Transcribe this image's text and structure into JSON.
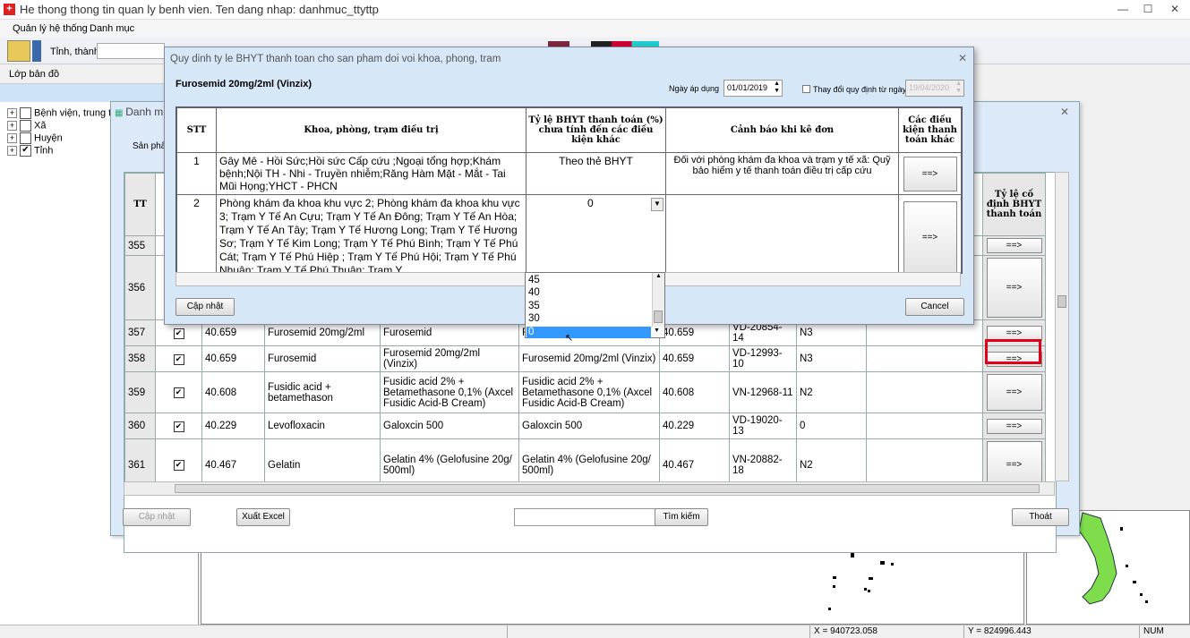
{
  "window": {
    "title": "He thong thong tin quan ly benh vien. Ten dang nhap: danhmuc_ttyttp"
  },
  "menu": {
    "items": [
      "Quản lý hệ thống",
      "Danh mục"
    ]
  },
  "toolbar": {
    "province_label": "Tỉnh, thành:"
  },
  "layer": {
    "label": "Lớp bản đồ"
  },
  "tree": {
    "items": [
      {
        "label": "Bệnh viện, trung tâm",
        "checked": false
      },
      {
        "label": "Xã",
        "checked": false
      },
      {
        "label": "Huyện",
        "checked": false
      },
      {
        "label": "Tỉnh",
        "checked": true
      }
    ]
  },
  "status": {
    "x": "X = 940723.058",
    "y": "Y = 824996.443",
    "num": "NUM"
  },
  "big_dialog": {
    "title": "Danh m",
    "product_label": "Sản phẩm",
    "col_tt": "TT",
    "col_bhyt": "Tỷ lệ cố định BHYT thanh toán",
    "rows": [
      {
        "tt": "355",
        "checked": false,
        "code": "",
        "name": "",
        "full": "",
        "full2": "",
        "code2": "",
        "reg": "",
        "grp": "",
        "tall": false
      },
      {
        "tt": "356",
        "checked": false,
        "code": "",
        "name": "",
        "full": "",
        "full2": "",
        "code2": "",
        "reg": "",
        "grp": "",
        "tall": true
      },
      {
        "tt": "357",
        "checked": true,
        "code": "40.659",
        "name": "Furosemid 20mg/2ml",
        "full": "Furosemid",
        "full2": "F",
        "code2": "40.659",
        "reg": "VD-20854-14",
        "grp": "N3",
        "tall": false
      },
      {
        "tt": "358",
        "checked": true,
        "code": "40.659",
        "name": "Furosemid",
        "full": "Furosemid 20mg/2ml (Vinzix)",
        "full2": "Furosemid 20mg/2ml (Vinzix)",
        "code2": "40.659",
        "reg": "VD-12993-10",
        "grp": "N3",
        "tall": false
      },
      {
        "tt": "359",
        "checked": true,
        "code": "40.608",
        "name": "Fusidic acid + betamethason",
        "full": "Fusidic acid 2% + Betamethasone 0,1% (Axcel Fusidic Acid-B Cream)",
        "full2": "Fusidic acid 2% + Betamethasone 0,1% (Axcel Fusidic Acid-B Cream)",
        "code2": "40.608",
        "reg": "VN-12968-11",
        "grp": "N2",
        "tall": false
      },
      {
        "tt": "360",
        "checked": true,
        "code": "40.229",
        "name": "Levofloxacin",
        "full": "Galoxcin 500",
        "full2": "Galoxcin 500",
        "code2": "40.229",
        "reg": "VD-19020-13",
        "grp": "0",
        "tall": false
      },
      {
        "tt": "361",
        "checked": true,
        "code": "40.467",
        "name": "Gelatin",
        "full": "Gelatin 4% (Gelofusine 20g/ 500ml)",
        "full2": "Gelatin 4% (Gelofusine 20g/ 500ml)",
        "code2": "40.467",
        "reg": "VN-20882-18",
        "grp": "N2",
        "tall": false
      }
    ],
    "arrow": "==>",
    "btn_update": "Cập nhật",
    "btn_export": "Xuất Excel",
    "btn_search": "Tìm kiếm",
    "btn_exit": "Thoát"
  },
  "front_dialog": {
    "title": "Quy dinh ty le BHYT thanh toan  cho san pham doi voi  khoa, phong, tram",
    "product": "Furosemid 20mg/2ml (Vinzix)",
    "date_label": "Ngày áp dụng",
    "date_value": "01/01/2019",
    "change_label": "Thay đổi quy định từ ngày",
    "change_date": "19/04/2020",
    "headers": {
      "stt": "STT",
      "dept": "Khoa, phòng, trạm điều trị",
      "rate": "Tỷ lệ BHYT thanh toán (%) chưa tính đến các điều kiện khác",
      "warn": "Cảnh báo khi kê đơn",
      "other": "Các điều kiện thanh toán khác"
    },
    "rows": [
      {
        "stt": "1",
        "dept": "Gây Mê - Hồi Sức;Hồi sức Cấp cứu ;Ngoại tổng hợp;Khám bệnh;Nội TH - Nhi - Truyền nhiễm;Răng Hàm Mặt - Mắt - Tai Mũi Họng;YHCT - PHCN",
        "rate": "Theo thẻ BHYT",
        "warn": "Đối với phòng khám đa khoa và trạm y tế xã: Quỹ bảo hiểm y tế thanh toán điều trị cấp cứu"
      },
      {
        "stt": "2",
        "dept": "Phòng khám đa khoa khu vực 2; Phòng khám đa khoa khu vực 3; Trạm Y Tế An Cựu; Trạm Y Tế An Đông; Trạm Y Tế An Hòa; Trạm Y Tế An Tây; Trạm Y Tế Hương Long; Trạm Y Tế Hương Sơ; Trạm Y Tế Kim Long; Trạm Y Tế Phú Bình; Trạm Y Tế Phú Cát; Trạm Y Tế Phú Hiệp ; Trạm Y Tế Phú Hội; Trạm Y Tế Phú Nhuận; Trạm Y Tế Phú Thuận; Trạm Y",
        "rate": "0",
        "warn": ""
      }
    ],
    "arrow": "==>",
    "dropdown_options": [
      "45",
      "40",
      "35",
      "30",
      "0"
    ],
    "btn_update": "Cập nhật",
    "btn_cancel": "Cancel"
  }
}
